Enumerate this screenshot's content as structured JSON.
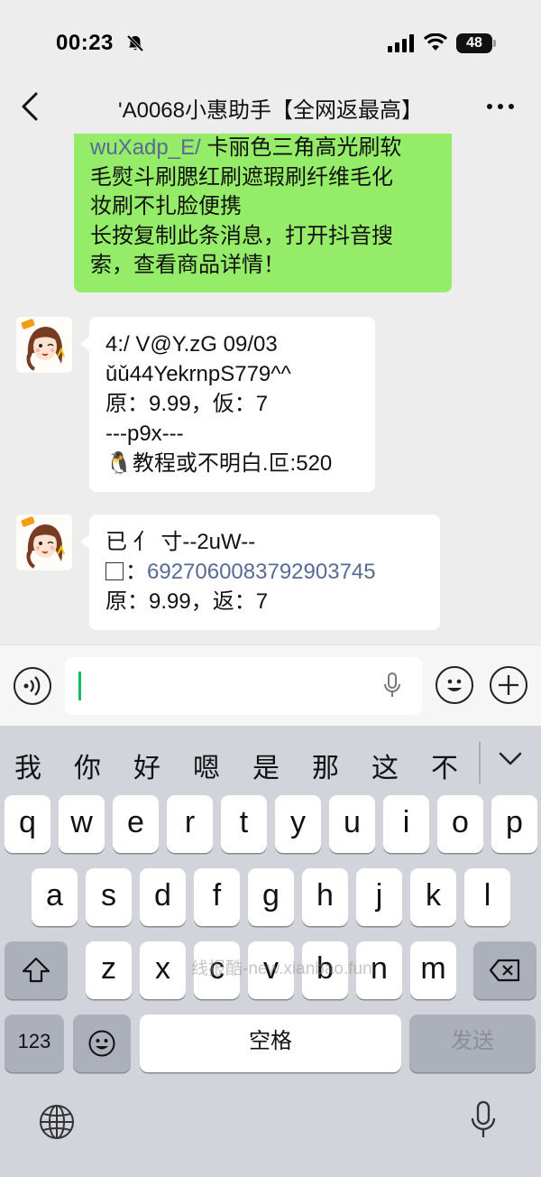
{
  "status_bar": {
    "time": "00:23",
    "battery": "48"
  },
  "nav": {
    "title": "'A0068小惠助手【全网返最高】"
  },
  "messages": {
    "outgoing": {
      "link": "wuXadp_E/",
      "line1_rest": " 卡丽色三角高光刷软",
      "line2": "毛熨斗刷腮红刷遮瑕刷纤维毛化",
      "line3": "妆刷不扎脸便携",
      "line4": "长按复制此条消息，打开抖音搜",
      "line5": "索，查看商品详情！"
    },
    "incoming1": {
      "line1": "4:/ V@Y.zG 09/03",
      "line2": "ǔǔ44YekrnpS779^^",
      "line3": "原：9.99，仮：7",
      "line4": "---p9x---",
      "line5_icon": "🐧",
      "line5": "教程或不明白.叵:520"
    },
    "incoming2": {
      "line1": "已  亻 寸--2uW--",
      "line2_prefix": "：",
      "line2_link": "6927060083792903745",
      "line3": "原：9.99，返：7"
    }
  },
  "keyboard": {
    "candidates": [
      "我",
      "你",
      "好",
      "嗯",
      "是",
      "那",
      "这",
      "不"
    ],
    "row1": [
      "q",
      "w",
      "e",
      "r",
      "t",
      "y",
      "u",
      "i",
      "o",
      "p"
    ],
    "row2": [
      "a",
      "s",
      "d",
      "f",
      "g",
      "h",
      "j",
      "k",
      "l"
    ],
    "row3": [
      "z",
      "x",
      "c",
      "v",
      "b",
      "n",
      "m"
    ],
    "num_label": "123",
    "space_label": "空格",
    "send_label": "发送"
  },
  "watermark": "线报酷-new.xianbao.fun"
}
